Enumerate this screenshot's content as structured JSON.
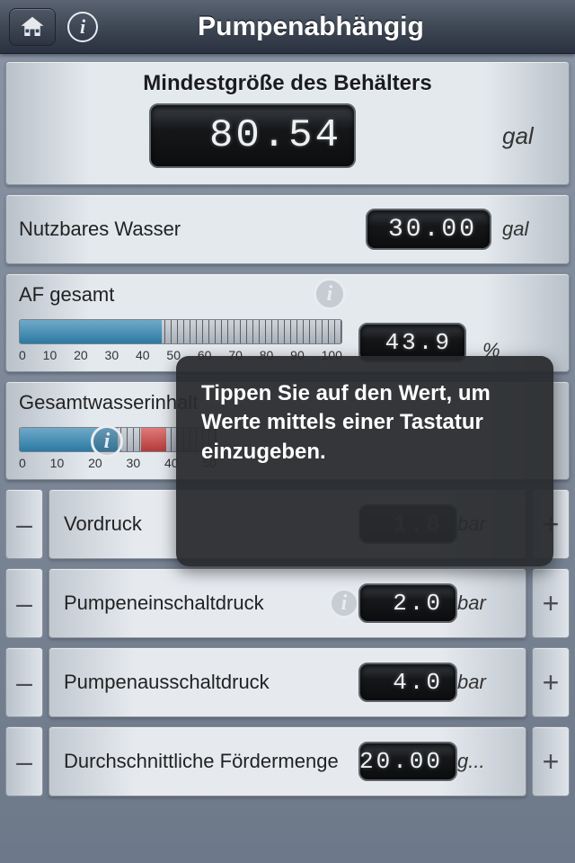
{
  "header": {
    "title": "Pumpenabhängig"
  },
  "main_result": {
    "title": "Mindestgröße des Behälters",
    "value": "80.54",
    "unit": "gal"
  },
  "usable_water": {
    "label": "Nutzbares Wasser",
    "value": "30.00",
    "unit": "gal"
  },
  "af_total": {
    "label": "AF gesamt",
    "value": "43.9",
    "unit": "%",
    "scale": [
      "0",
      "10",
      "20",
      "30",
      "40",
      "50",
      "60",
      "70",
      "80",
      "90",
      "100"
    ],
    "fill_pct": 44
  },
  "total_volume": {
    "label": "Gesamtwasserinhalt",
    "scale": [
      "0",
      "10",
      "20",
      "30",
      "40",
      "50"
    ],
    "fill_pct": 50
  },
  "rows": [
    {
      "label": "Vordruck",
      "value": "1.8",
      "unit": "bar"
    },
    {
      "label": "Pumpeneinschaltdruck",
      "value": "2.0",
      "unit": "bar"
    },
    {
      "label": "Pumpenausschaltdruck",
      "value": "4.0",
      "unit": "bar"
    },
    {
      "label": "Durchschnittliche Fördermenge",
      "value": "20.00",
      "unit": "g..."
    }
  ],
  "tooltip": {
    "text": "Tippen Sie auf den Wert, um Werte mittels einer Tastatur einzugeben."
  }
}
